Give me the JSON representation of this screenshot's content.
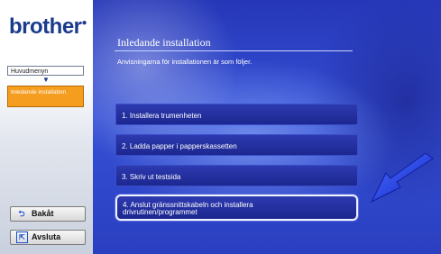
{
  "brand": {
    "logo_text": "brother"
  },
  "sidebar": {
    "breadcrumb_main": "Huvudmenyn",
    "breadcrumb_current": "Inledande installation",
    "back_label": "Bakåt",
    "exit_label": "Avsluta"
  },
  "main": {
    "title": "Inledande installation",
    "subtitle": "Anvisningarna för installationen är som följer.",
    "options": [
      {
        "label": "1. Installera trumenheten"
      },
      {
        "label": "2. Ladda papper i papperskassetten"
      },
      {
        "label": "3. Skriv ut testsida"
      },
      {
        "label_line1": "4. Anslut gränssnittskabeln och installera",
        "label_line2": "drivrutinen/programmet"
      }
    ]
  },
  "colors": {
    "panel_blue": "#2f45c8",
    "highlight_orange": "#f59d1f",
    "arrow_blue": "#1f3fe0"
  }
}
